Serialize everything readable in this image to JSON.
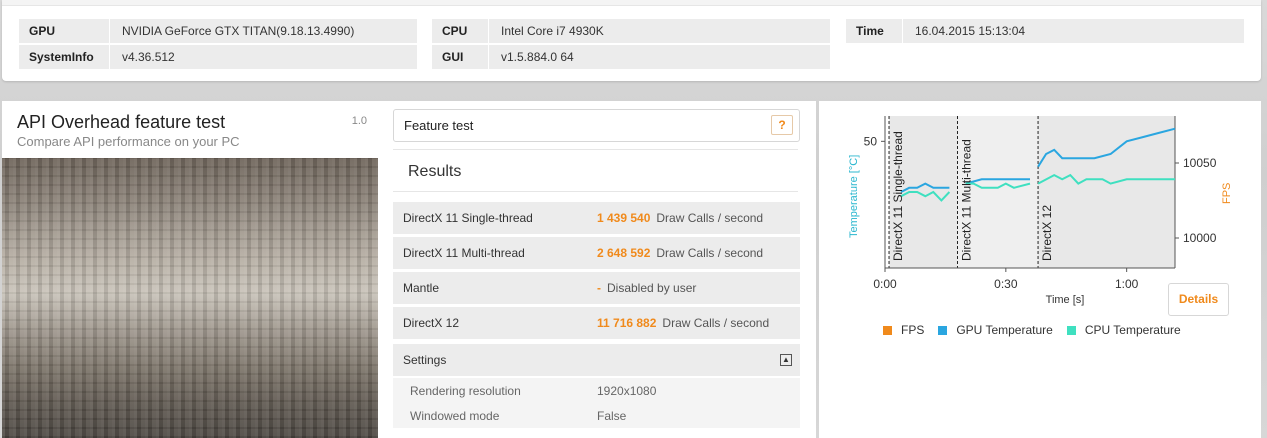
{
  "system_info": {
    "gpu_label": "GPU",
    "gpu_value": "NVIDIA GeForce GTX TITAN(9.18.13.4990)",
    "sysinfo_label": "SystemInfo",
    "sysinfo_value": "v4.36.512",
    "cpu_label": "CPU",
    "cpu_value": "Intel Core i7 4930K",
    "gui_label": "GUI",
    "gui_value": "v1.5.884.0 64",
    "time_label": "Time",
    "time_value": "16.04.2015 15:13:04"
  },
  "test": {
    "title": "API Overhead feature test",
    "subtitle": "Compare API performance on your PC",
    "version": "1.0"
  },
  "results": {
    "feature_test_label": "Feature test",
    "help_label": "?",
    "heading": "Results",
    "rows": [
      {
        "name": "DirectX 11 Single-thread",
        "value": "1 439 540",
        "unit": "Draw Calls / second"
      },
      {
        "name": "DirectX 11 Multi-thread",
        "value": "2 648 592",
        "unit": "Draw Calls / second"
      },
      {
        "name": "Mantle",
        "value": "-",
        "unit": "Disabled by user"
      },
      {
        "name": "DirectX 12",
        "value": "11 716 882",
        "unit": "Draw Calls / second"
      }
    ],
    "settings_label": "Settings",
    "settings": [
      {
        "name": "Rendering resolution",
        "value": "1920x1080"
      },
      {
        "name": "Windowed mode",
        "value": "False"
      }
    ]
  },
  "chart": {
    "details_label": "Details",
    "legend": [
      {
        "label": "FPS",
        "color": "#f08a1c"
      },
      {
        "label": "GPU Temperature",
        "color": "#2aa6e0"
      },
      {
        "label": "CPU Temperature",
        "color": "#3fe0c0"
      }
    ]
  },
  "chart_data": {
    "type": "line",
    "xlabel": "Time [s]",
    "ylabel_left": "Temperature [°C]",
    "ylabel_right": "FPS",
    "x_ticks": [
      "0:00",
      "0:30",
      "1:00"
    ],
    "y_left_ticks": [
      50
    ],
    "y_right_ticks": [
      10050,
      10000
    ],
    "xlim": [
      0,
      72
    ],
    "ylim_left": [
      20,
      56
    ],
    "grid": false,
    "sections": [
      {
        "label": "DirectX 11 Single-thread",
        "start": 1
      },
      {
        "label": "DirectX 11 Multi-thread",
        "start": 18
      },
      {
        "label": "DirectX 12",
        "start": 38
      }
    ],
    "series": [
      {
        "name": "GPU Temperature",
        "color": "#2aa6e0",
        "segments": [
          [
            [
              4,
              38
            ],
            [
              6,
              39
            ],
            [
              8,
              39
            ],
            [
              10,
              40
            ],
            [
              12,
              39
            ],
            [
              14,
              39
            ],
            [
              16,
              39
            ]
          ],
          [
            [
              20,
              40
            ],
            [
              24,
              41
            ],
            [
              28,
              41
            ],
            [
              32,
              41
            ],
            [
              36,
              41
            ]
          ],
          [
            [
              38,
              44
            ],
            [
              40,
              47
            ],
            [
              42,
              48
            ],
            [
              44,
              46
            ],
            [
              48,
              46
            ],
            [
              52,
              46
            ],
            [
              56,
              47
            ],
            [
              60,
              50
            ],
            [
              64,
              51
            ],
            [
              68,
              52
            ],
            [
              72,
              53
            ]
          ]
        ]
      },
      {
        "name": "CPU Temperature",
        "color": "#3fe0c0",
        "segments": [
          [
            [
              4,
              37
            ],
            [
              6,
              38
            ],
            [
              8,
              38
            ],
            [
              10,
              37
            ],
            [
              12,
              38
            ],
            [
              14,
              36
            ],
            [
              16,
              38
            ]
          ],
          [
            [
              20,
              40
            ],
            [
              22,
              40
            ],
            [
              24,
              39
            ],
            [
              28,
              39
            ],
            [
              30,
              40
            ],
            [
              32,
              39
            ],
            [
              36,
              40
            ]
          ],
          [
            [
              38,
              40
            ],
            [
              42,
              42
            ],
            [
              44,
              41
            ],
            [
              46,
              42
            ],
            [
              48,
              40
            ],
            [
              50,
              41
            ],
            [
              54,
              41
            ],
            [
              56,
              40
            ],
            [
              60,
              41
            ],
            [
              64,
              41
            ],
            [
              68,
              41
            ],
            [
              72,
              41
            ]
          ]
        ]
      }
    ]
  }
}
